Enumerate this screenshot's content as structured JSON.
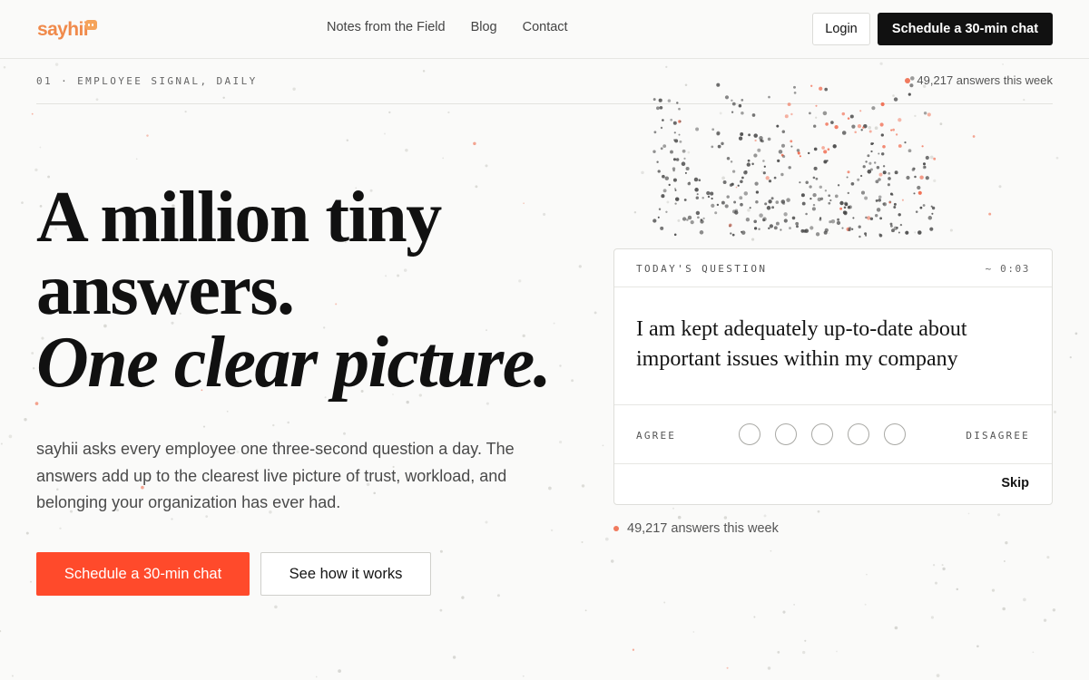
{
  "brand": {
    "name": "sayhii",
    "logo_color": "#f08a4b",
    "accent": "#ff4a2b"
  },
  "nav": {
    "links": [
      "Notes from the Field",
      "Blog",
      "Contact"
    ],
    "login_label": "Login",
    "cta_label": "Schedule a 30-min chat"
  },
  "eyebrow": {
    "label": "01 · EMPLOYEE SIGNAL, DAILY",
    "answers_count": "49,217 answers this week"
  },
  "hero": {
    "headline_line1": "A million tiny",
    "headline_line2": "answers.",
    "headline_line3": "One clear picture.",
    "subtext": "sayhii asks every employee one three-second question a day. The answers add up to the clearest live picture of trust, workload, and belonging your organization has ever had.",
    "primary_cta": "Schedule a 30-min chat",
    "secondary_cta": "See how it works"
  },
  "question_card": {
    "label": "TODAY'S QUESTION",
    "timer": "~ 0:03",
    "question": "I am kept adequately up-to-date about important issues within my company",
    "scale_left": "AGREE",
    "scale_right": "DISAGREE",
    "options_count": 5,
    "skip_label": "Skip"
  },
  "footer_count": "49,217 answers this week",
  "icons": {
    "live_indicator": "live-dot-icon",
    "scale_option": "radio-circle-icon"
  }
}
